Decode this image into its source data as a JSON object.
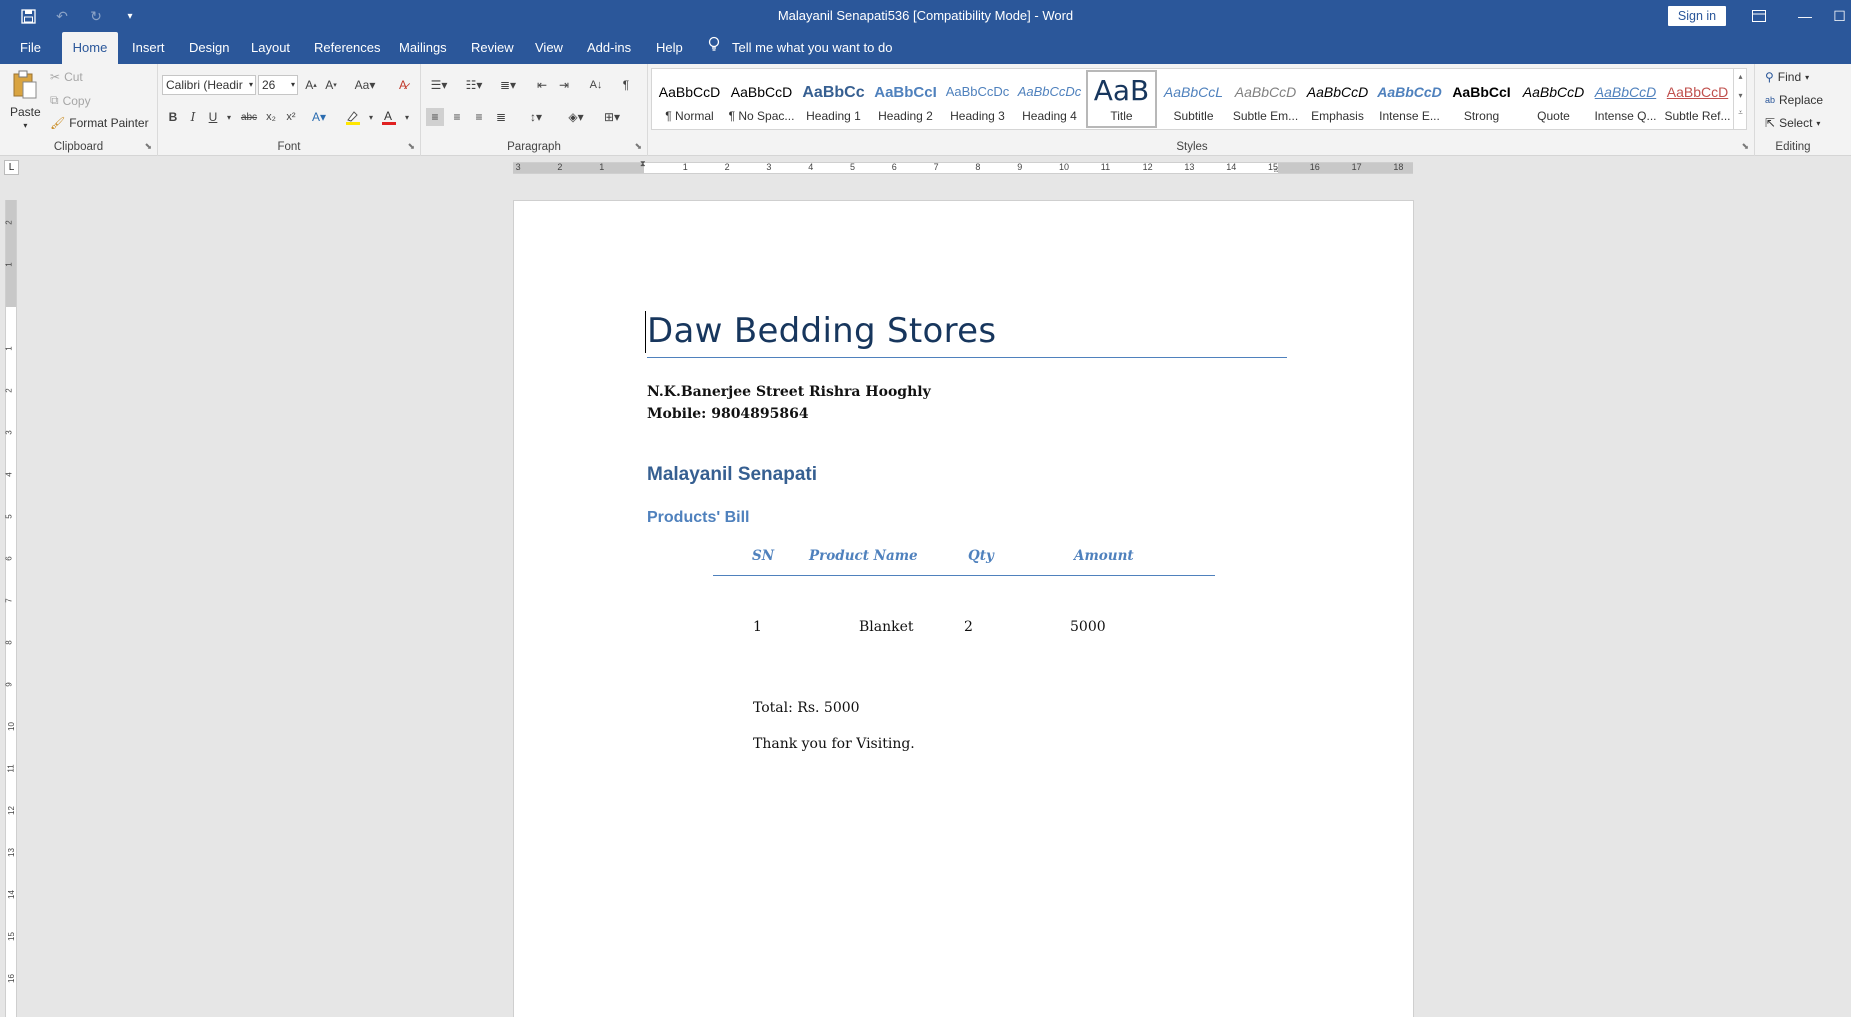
{
  "window": {
    "title": "Malayanil Senapati536 [Compatibility Mode]  -  Word",
    "sign_in": "Sign in"
  },
  "tabs": [
    "File",
    "Home",
    "Insert",
    "Design",
    "Layout",
    "References",
    "Mailings",
    "Review",
    "View",
    "Add-ins",
    "Help"
  ],
  "tell_me": "Tell me what you want to do",
  "clipboard": {
    "paste": "Paste",
    "cut": "Cut",
    "copy": "Copy",
    "format_painter": "Format Painter",
    "label": "Clipboard"
  },
  "font": {
    "name": "Calibri (Headir",
    "size": "26",
    "label": "Font"
  },
  "paragraph": {
    "label": "Paragraph"
  },
  "styles": {
    "label": "Styles",
    "items": [
      {
        "sample": "AaBbCcD",
        "name": "¶ Normal"
      },
      {
        "sample": "AaBbCcD",
        "name": "¶ No Spac..."
      },
      {
        "sample": "AaBbCc",
        "name": "Heading 1"
      },
      {
        "sample": "AaBbCcI",
        "name": "Heading 2"
      },
      {
        "sample": "AaBbCcDc",
        "name": "Heading 3"
      },
      {
        "sample": "AaBbCcDc",
        "name": "Heading 4"
      },
      {
        "sample": "AaB",
        "name": "Title"
      },
      {
        "sample": "AaBbCcL",
        "name": "Subtitle"
      },
      {
        "sample": "AaBbCcD",
        "name": "Subtle Em..."
      },
      {
        "sample": "AaBbCcD",
        "name": "Emphasis"
      },
      {
        "sample": "AaBbCcD",
        "name": "Intense E..."
      },
      {
        "sample": "AaBbCcI",
        "name": "Strong"
      },
      {
        "sample": "AaBbCcD",
        "name": "Quote"
      },
      {
        "sample": "AaBbCcD",
        "name": "Intense Q..."
      },
      {
        "sample": "AaBbCcD",
        "name": "Subtle Ref..."
      }
    ]
  },
  "editing": {
    "find": "Find",
    "replace": "Replace",
    "select": "Select",
    "label": "Editing"
  },
  "ruler": {
    "h_labels": [
      "3",
      "2",
      "1",
      "1",
      "2",
      "3",
      "4",
      "5",
      "6",
      "7",
      "8",
      "9",
      "10",
      "11",
      "12",
      "13",
      "14",
      "15",
      "16",
      "17",
      "18"
    ],
    "v_labels": [
      "2",
      "1",
      "1",
      "2",
      "3",
      "4",
      "5",
      "6",
      "7",
      "8",
      "9",
      "10",
      "11",
      "12",
      "13",
      "14",
      "15",
      "16"
    ]
  },
  "document": {
    "title": "Daw Bedding Stores",
    "address": "N.K.Banerjee Street Rishra Hooghly",
    "mobile": "Mobile: 9804895864",
    "customer": "Malayanil Senapati",
    "bill_heading": "Products' Bill",
    "table": {
      "headers": [
        "SN",
        "Product Name",
        "Qty",
        "Amount"
      ],
      "row": [
        "1",
        "Blanket",
        "2",
        "5000"
      ]
    },
    "total": "Total: Rs. 5000",
    "thanks": "Thank you for Visiting."
  }
}
